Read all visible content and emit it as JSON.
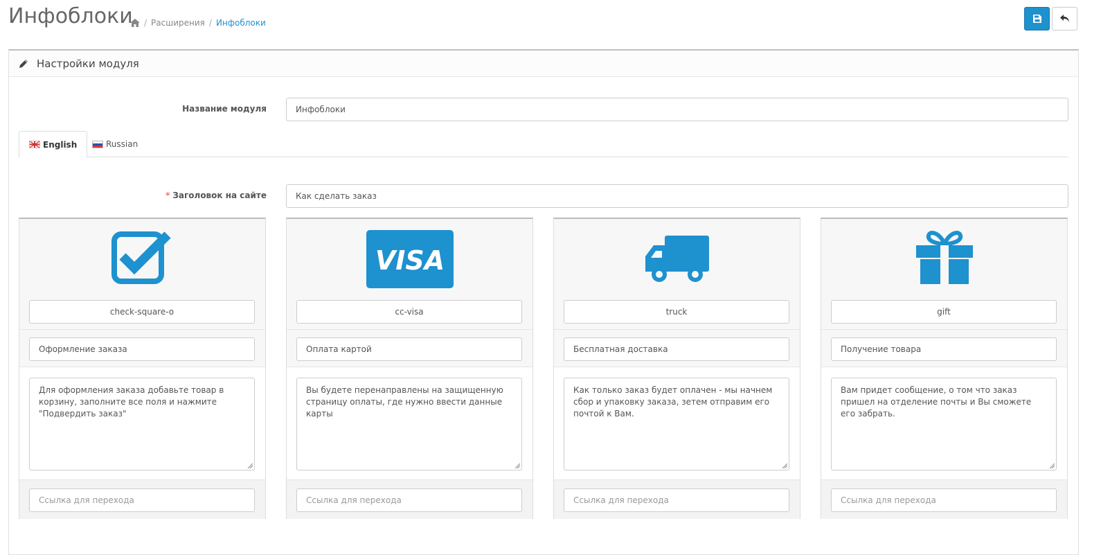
{
  "header": {
    "title": "Инфоблоки",
    "breadcrumb": [
      "Расширения",
      "Инфоблоки"
    ],
    "save_icon": "save-icon",
    "back_icon": "reply-icon"
  },
  "panel": {
    "heading": "Настройки модуля",
    "module_name_label": "Название модуля",
    "module_name_value": "Инфоблоки",
    "tabs": [
      "English",
      "Russian"
    ],
    "site_title_label": "Заголовок на сайте",
    "site_title_value": "Как сделать заказ"
  },
  "colors": {
    "accent": "#1e91cf",
    "required": "#f56b6b"
  },
  "cards": [
    {
      "icon": "check-square-o",
      "title": "Оформление заказа",
      "text": "Для оформления заказа добавьте товар в корзину, заполните все поля и нажмите \"Подвердить заказ\"",
      "link_placeholder": "Ссылка для перехода"
    },
    {
      "icon": "cc-visa",
      "title": "Оплата картой",
      "text": "Вы будете перенаправлены на защищенную страницу оплаты, где нужно ввести данные карты",
      "link_placeholder": "Ссылка для перехода"
    },
    {
      "icon": "truck",
      "title": "Бесплатная доставка",
      "text": "Как только заказ будет оплачен - мы начнем сбор и упаковку заказа, зетем отправим его почтой к Вам.",
      "link_placeholder": "Ссылка для перехода"
    },
    {
      "icon": "gift",
      "title": "Получение товара",
      "text": "Вам придет сообщение, о том что заказ пришел на отделение почты и Вы сможете его забрать.",
      "link_placeholder": "Ссылка для перехода"
    }
  ]
}
